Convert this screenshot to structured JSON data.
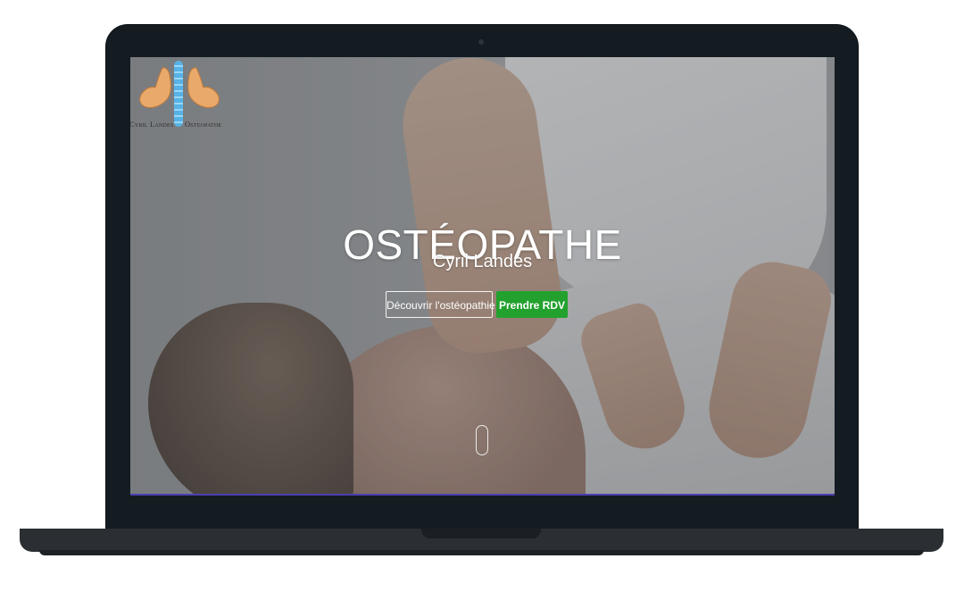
{
  "logo": {
    "text_left": "Cyril Landes",
    "text_right": "Osteopathe",
    "icon": "hands-spine-logo"
  },
  "hero": {
    "title": "OSTÉOPATHE",
    "subtitle": "Cyril Landes",
    "buttons": {
      "discover_label": "Découvrir l'ostéopathie",
      "appointment_label": "Prendre RDV"
    },
    "scroll_indicator_icon": "mouse-scroll-icon"
  },
  "colors": {
    "accent": "#22a12e",
    "laptop_frame": "#141c22",
    "logo_spine": "#57b2e6",
    "logo_hands": "#e8a96a"
  }
}
